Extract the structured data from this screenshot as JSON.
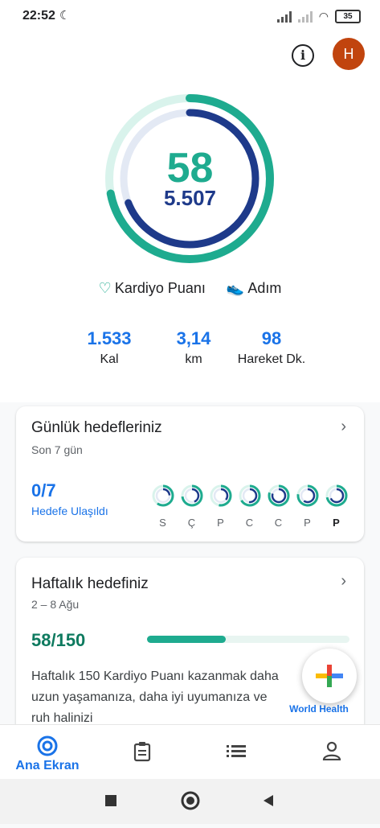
{
  "status_bar": {
    "time": "22:52",
    "battery": "35"
  },
  "header": {
    "avatar_initial": "H"
  },
  "summary": {
    "heart_points": "58",
    "steps": "5.507",
    "legend_heart": "Kardiyo Puanı",
    "legend_steps": "Adım",
    "stats": [
      {
        "value": "1.533",
        "label": "Kal"
      },
      {
        "value": "3,14",
        "label": "km"
      },
      {
        "value": "98",
        "label": "Hareket Dk."
      }
    ],
    "heart_ring_progress": 0.72,
    "steps_ring_progress": 0.69
  },
  "daily_goals": {
    "title": "Günlük hedefleriniz",
    "subtitle": "Son 7 gün",
    "achieved": "0/7",
    "achieved_label": "Hedefe Ulaşıldı",
    "days": [
      "S",
      "Ç",
      "P",
      "C",
      "C",
      "P",
      "P"
    ]
  },
  "weekly_goal": {
    "title": "Haftalık hedefiniz",
    "subtitle": "2 – 8 Ağu",
    "progress_text": "58/150",
    "progress_fraction": 0.39,
    "description": "Haftalık 150 Kardiyo Puanı kazanmak daha uzun yaşamanıza, daha iyi uyumanıza ve ruh halinizi",
    "org_label": "World Health"
  },
  "bottom_nav": {
    "home_label": "Ana Ekran"
  },
  "colors": {
    "heart": "#1eab8f",
    "steps": "#1e3a8a",
    "link": "#1a73e8"
  }
}
